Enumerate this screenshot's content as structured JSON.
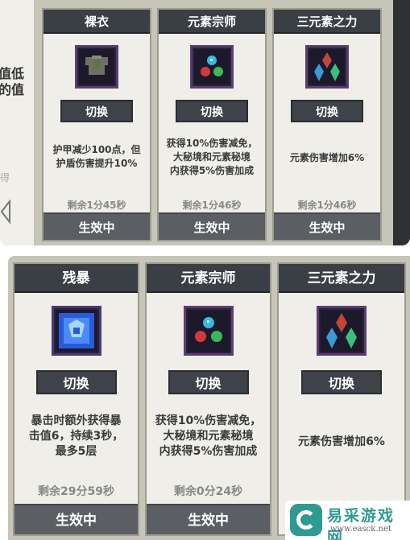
{
  "top_panel": {
    "partial_card": {
      "line1": "值低",
      "line2": "的值",
      "small_text": "得"
    },
    "cards": [
      {
        "title": "裸衣",
        "icon": "armor-shirt-icon",
        "switch_label": "切换",
        "description": "护甲减少100点，但\n护盾伤害提升10%",
        "remaining": "剩余1分45秒",
        "status": "生效中"
      },
      {
        "title": "元素宗师",
        "icon": "element-orbs-icon",
        "switch_label": "切换",
        "description": "获得10%伤害减免，\n大秘境和元素秘境\n内获得5%伤害加成",
        "remaining": "剩余1分46秒",
        "status": "生效中"
      },
      {
        "title": "三元素之力",
        "icon": "three-crystals-icon",
        "switch_label": "切换",
        "description": "元素伤害增加6%",
        "remaining": "剩余1分46秒",
        "status": "生效中"
      }
    ]
  },
  "bottom_panel": {
    "cards": [
      {
        "title": "残暴",
        "icon": "blue-rage-icon",
        "switch_label": "切换",
        "description": "暴击时额外获得暴\n击值6，持续3秒，\n最多5层",
        "remaining": "剩余29分59秒",
        "status": "生效中"
      },
      {
        "title": "元素宗师",
        "icon": "element-orbs-icon",
        "switch_label": "切换",
        "description": "获得10%伤害减免，\n大秘境和元素秘境\n内获得5%伤害加成",
        "remaining": "剩余0分24秒",
        "status": "生效中"
      },
      {
        "title": "三元素之力",
        "icon": "three-crystals-icon",
        "switch_label": "切换",
        "description": "元素伤害增加6%",
        "remaining": "",
        "status": ""
      }
    ]
  },
  "watermark": {
    "title": "易采游戏网",
    "url": "www.easck.net"
  }
}
